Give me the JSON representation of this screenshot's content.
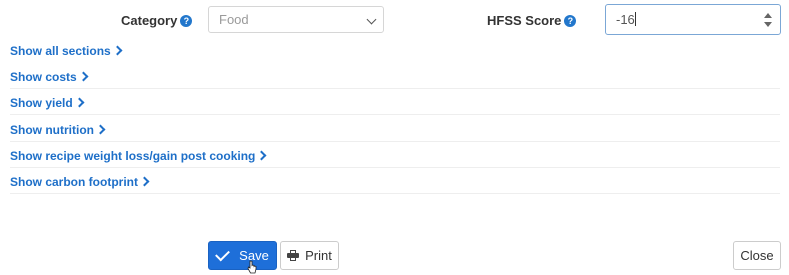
{
  "form": {
    "category": {
      "label": "Category",
      "help_icon": "question-circle-icon",
      "selected": "Food"
    },
    "hfss": {
      "label": "HFSS Score",
      "help_icon": "question-circle-icon",
      "value": "-16"
    }
  },
  "sections": [
    {
      "label": "Show all sections"
    },
    {
      "label": "Show costs"
    },
    {
      "label": "Show yield"
    },
    {
      "label": "Show nutrition"
    },
    {
      "label": "Show recipe weight loss/gain post cooking"
    },
    {
      "label": "Show carbon footprint"
    }
  ],
  "actions": {
    "save_label": "Save",
    "print_label": "Print",
    "close_label": "Close"
  },
  "colors": {
    "link": "#1e6fc8",
    "primary": "#1e6fd9"
  }
}
